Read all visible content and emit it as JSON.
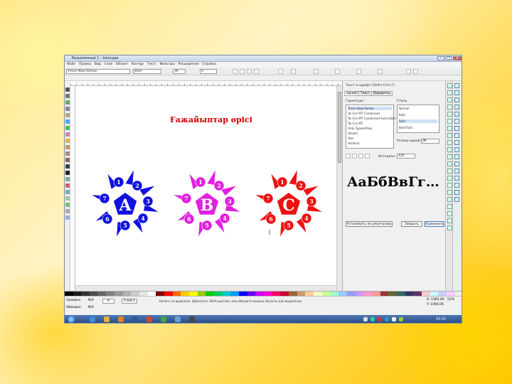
{
  "window": {
    "title": "Безымянный 1 - Inkscape"
  },
  "menu": [
    "Файл",
    "Правка",
    "Вид",
    "Слой",
    "Объект",
    "Контур",
    "Текст",
    "Фильтры",
    "Расширения",
    "Справка"
  ],
  "toolctl": {
    "font_family": "Times New Roman",
    "font_style": "Bold",
    "font_size": "36",
    "spacing": "0"
  },
  "canvas": {
    "title": "Ғажайыптар өрісі",
    "title_color": "#d00000",
    "balls": [
      {
        "letter": "A",
        "color": "#1010e0",
        "numbers": [
          "1",
          "2",
          "3",
          "4",
          "5",
          "6",
          "7"
        ]
      },
      {
        "letter": "B",
        "color": "#e020e0",
        "numbers": [
          "1",
          "2",
          "3",
          "4",
          "5",
          "6",
          "7"
        ]
      },
      {
        "letter": "C",
        "color": "#ee1111",
        "numbers": [
          "1",
          "2",
          "3",
          "4",
          "5",
          "6",
          "7"
        ]
      }
    ]
  },
  "panel": {
    "title": "Текст и шрифт (Shift+Ctrl+T)",
    "tabs": [
      "Шрифт",
      "Текст",
      "Варианты"
    ],
    "family_label": "Гарнитура",
    "style_label": "Стиль",
    "fonts": [
      "Times New Roman",
      "Tw Cen MT Condensed",
      "Tw Cen MT Condensed Extra Bold",
      "Tw Cen MT",
      "Urdu Typesetting",
      "Utsaah",
      "Vani",
      "Verdana",
      "Vijaya"
    ],
    "styles": [
      "Normal",
      "Italic",
      "Bold",
      "Bold Italic"
    ],
    "size_label": "Размер шрифта:",
    "size_value": "36",
    "spacing_label": "Интервал:",
    "spacing_value": "125",
    "preview": "АаБбВвГг…",
    "buttons": {
      "default": "Установить по умолчанию",
      "close": "Закрыть",
      "apply": "Применить"
    }
  },
  "status": {
    "fill_label": "Заливка:",
    "stroke_label": "Обводка:",
    "fill_value": "N/A",
    "stroke_value": "N/A",
    "opacity": "0",
    "layer": "Слой 1",
    "message": "Ничего не выделено. Щёлкните, Shift+щелчок, или обведите мышью объекты для выделения",
    "coords_x": "X: 1365,00",
    "coords_y": "Y: 1094,00",
    "zoom": "52%"
  },
  "taskbar": {
    "time": "15:01"
  }
}
